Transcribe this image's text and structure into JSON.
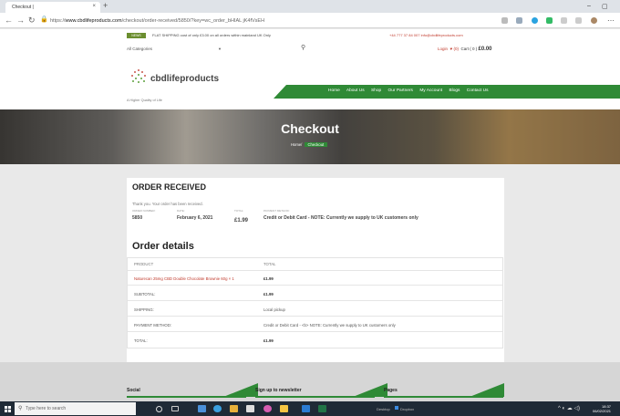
{
  "browser": {
    "tab_title": "Checkout |",
    "tab_close": "×",
    "new_tab": "+",
    "url_prefix": "https://",
    "url_domain": "www.cbdlifeproducts.com",
    "url_path": "/checkout/order-received/5850/?key=wc_order_bHIAL jK4fVsEH",
    "window_min": "–",
    "window_max": "▢"
  },
  "topbar": {
    "badge": "NEWS",
    "shipping_text": "FLAT SHIPPING cost of only £3.00 on all orders within mainland UK Only",
    "contact_text": "+44 777 37 84 007   info@cbdlifeproducts.com"
  },
  "header": {
    "category_select": "All Categories",
    "login": "Login",
    "wishlist": "♥ (0)",
    "cart_label": "Cart ( 0 )",
    "cart_amount": "£0.00",
    "logo_name": "cbdlifeproducts",
    "tagline": "A Higher Quality of Life",
    "menu": [
      "Home",
      "About Us",
      "Shop",
      "Our Partners",
      "My Account",
      "Blogs",
      "Contact Us"
    ]
  },
  "hero": {
    "title": "Checkout",
    "crumb_home": "Home/",
    "crumb_current": "Checkout"
  },
  "order": {
    "heading": "ORDER RECEIVED",
    "thank_you": "Thank you. Your order has been received.",
    "meta": [
      {
        "label": "ORDER NUMBER:",
        "value": "5850"
      },
      {
        "label": "DATE:",
        "value": "February 6, 2021"
      },
      {
        "label": "TOTAL:",
        "value": "£1.99"
      },
      {
        "label": "PAYMENT METHOD:",
        "value": "Credit or Debit Card - NOTE: Currently we supply to UK customers only"
      }
    ]
  },
  "details": {
    "heading": "Order details",
    "col_product": "PRODUCT",
    "col_total": "TOTAL",
    "rows": [
      {
        "label": "Naturecan 25mg CBD Double Chocolate Brownie 60g × 1",
        "value": "£1.99"
      },
      {
        "label": "SUBTOTAL:",
        "value": "£1.99"
      },
      {
        "label": "SHIPPING:",
        "value": "Local pickup"
      },
      {
        "label": "PAYMENT METHOD:",
        "value": "Credit or Debit Card - <b> NOTE: Currently we supply to UK customers only"
      },
      {
        "label": "TOTAL:",
        "value": "£1.99"
      }
    ]
  },
  "footer": {
    "col1": "Social",
    "col2": "Sign up to newsletter",
    "col3": "Pages"
  },
  "taskbar": {
    "search_placeholder": "Type here to search",
    "desktop_label": "Desktop",
    "dropbox_label": "Dropbox",
    "time": "18:37",
    "date": "06/02/2021"
  },
  "colors": {
    "brand_green": "#2f8a36",
    "link_red": "#c0392b"
  }
}
